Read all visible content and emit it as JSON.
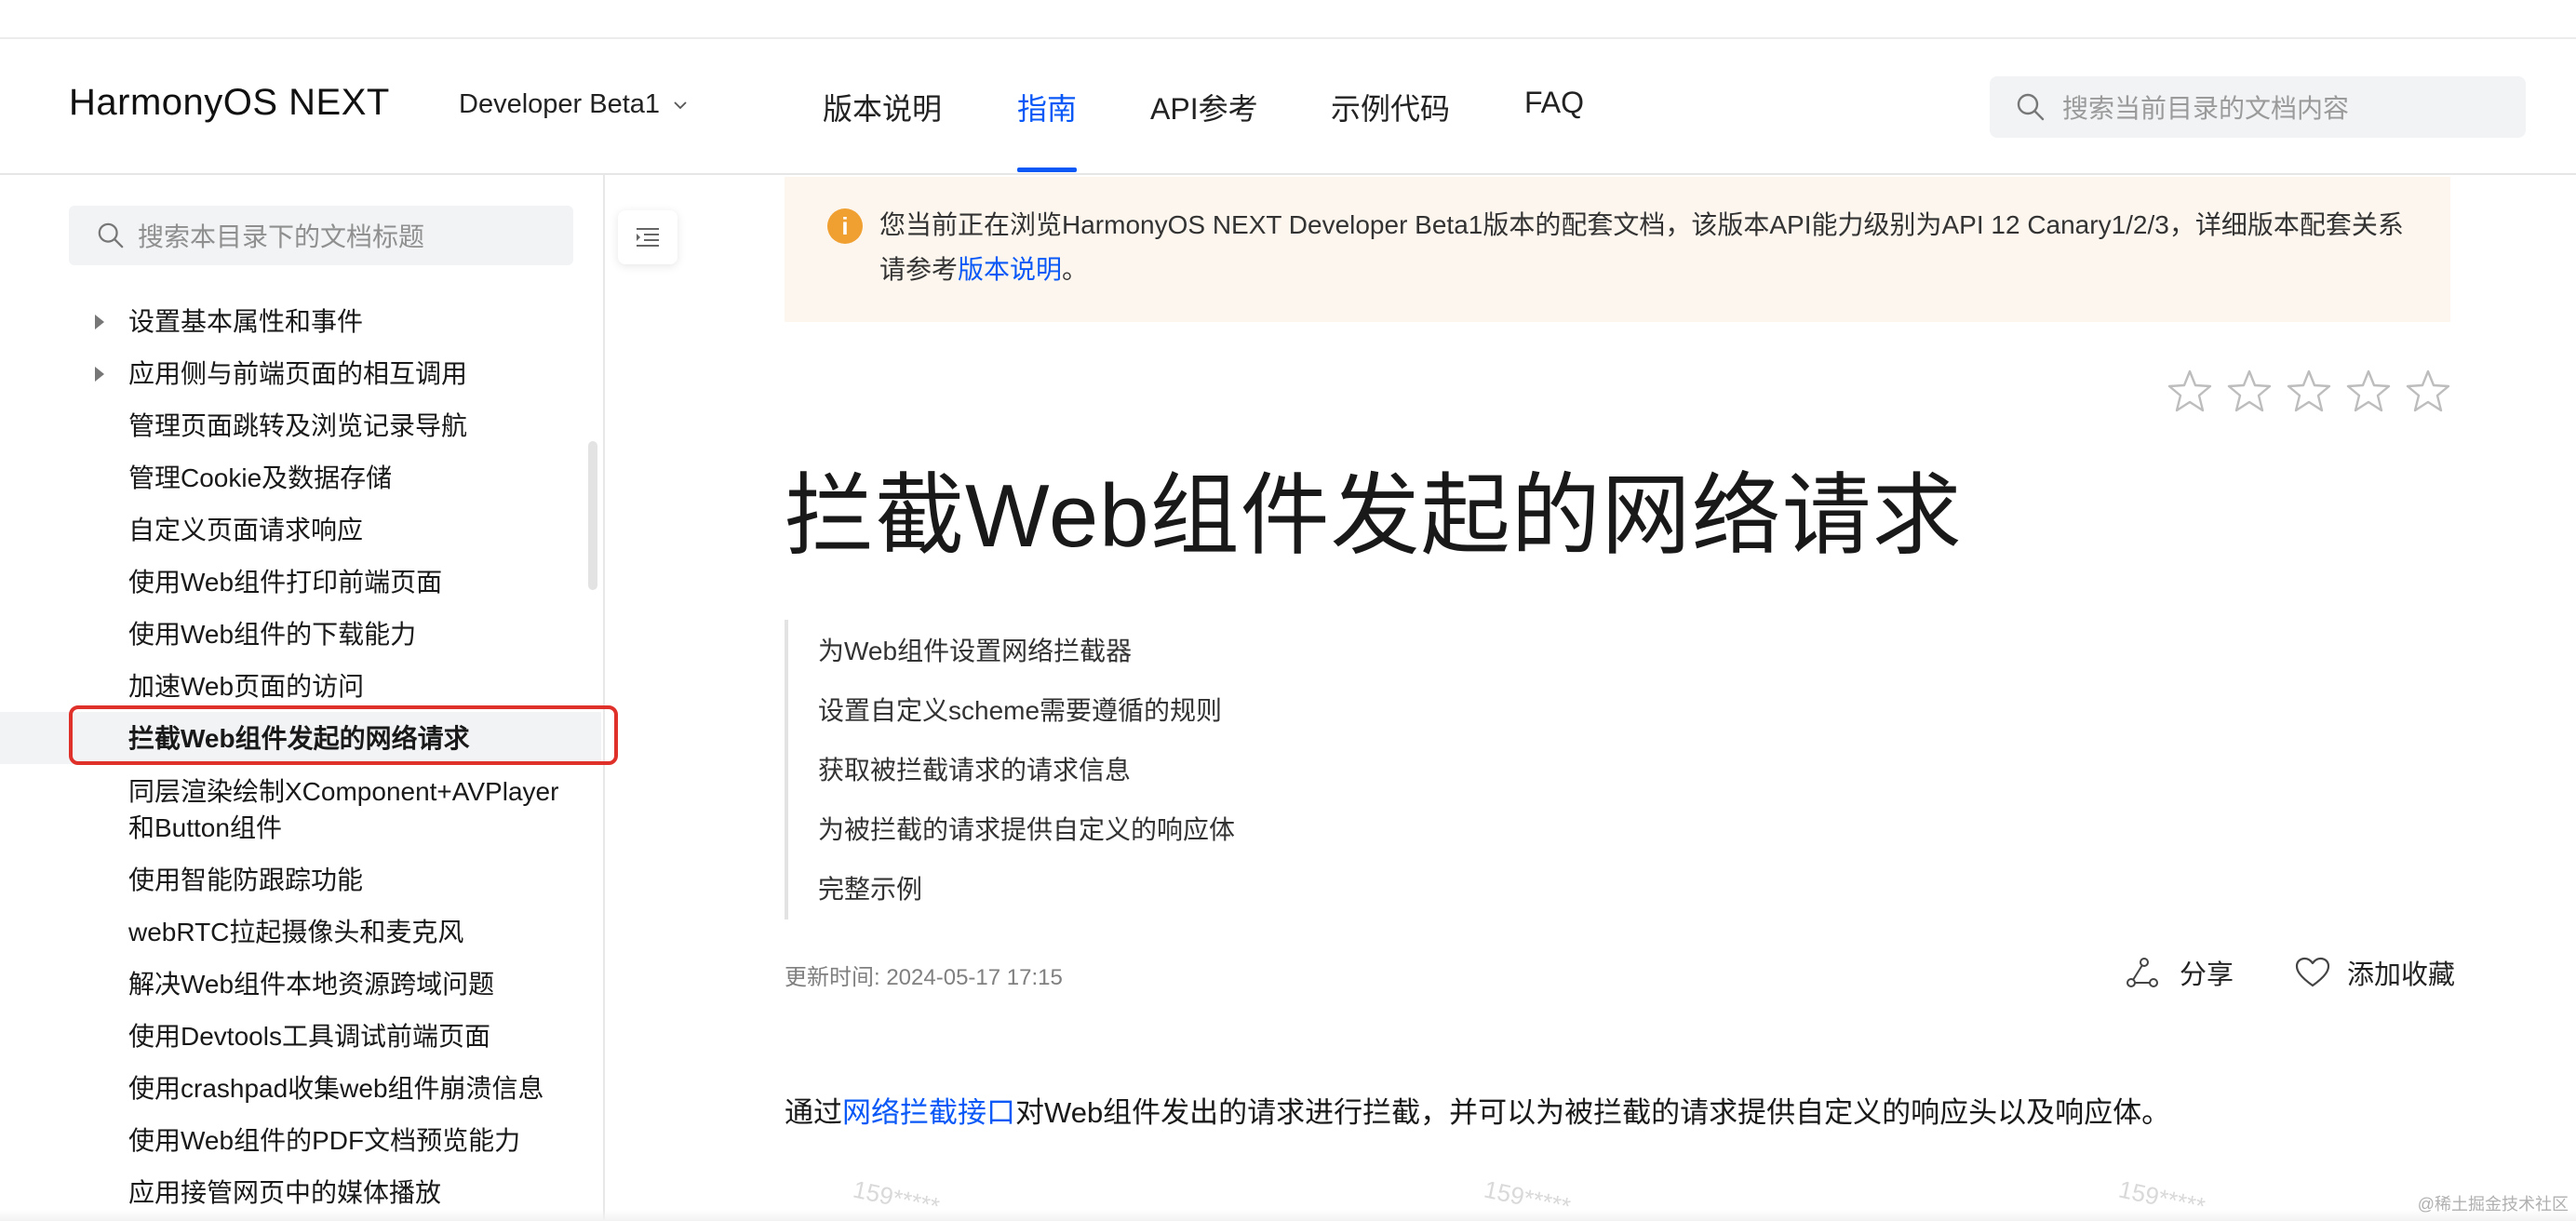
{
  "header": {
    "brand": "HarmonyOS NEXT",
    "version": "Developer Beta1",
    "nav": [
      {
        "label": "版本说明",
        "active": false
      },
      {
        "label": "指南",
        "active": true
      },
      {
        "label": "API参考",
        "active": false
      },
      {
        "label": "示例代码",
        "active": false
      },
      {
        "label": "FAQ",
        "active": false
      }
    ],
    "search_placeholder": "搜索当前目录的文档内容"
  },
  "sidebar": {
    "search_placeholder": "搜索本目录下的文档标题",
    "items": [
      {
        "label": "设置基本属性和事件",
        "expandable": true
      },
      {
        "label": "应用侧与前端页面的相互调用",
        "expandable": true
      },
      {
        "label": "管理页面跳转及浏览记录导航"
      },
      {
        "label": "管理Cookie及数据存储"
      },
      {
        "label": "自定义页面请求响应"
      },
      {
        "label": "使用Web组件打印前端页面"
      },
      {
        "label": "使用Web组件的下载能力"
      },
      {
        "label": "加速Web页面的访问"
      },
      {
        "label": "拦截Web组件发起的网络请求",
        "active": true
      },
      {
        "label": "同层渲染绘制XComponent+AVPlayer"
      },
      {
        "label": "和Button组件"
      },
      {
        "label": "使用智能防跟踪功能"
      },
      {
        "label": "webRTC拉起摄像头和麦克风"
      },
      {
        "label": "解决Web组件本地资源跨域问题"
      },
      {
        "label": "使用Devtools工具调试前端页面"
      },
      {
        "label": "使用crashpad收集web组件崩溃信息"
      },
      {
        "label": "使用Web组件的PDF文档预览能力"
      },
      {
        "label": "应用接管网页中的媒体播放"
      }
    ]
  },
  "notice": {
    "text_before": "您当前正在浏览HarmonyOS NEXT Developer Beta1版本的配套文档，该版本API能力级别为API 12 Canary1/2/3，详细版本配套关系请参考",
    "link": "版本说明",
    "text_after": "。"
  },
  "article": {
    "rating": {
      "value": 0,
      "max": 5
    },
    "title": "拦截Web组件发起的网络请求",
    "toc": [
      "为Web组件设置网络拦截器",
      "设置自定义scheme需要遵循的规则",
      "获取被拦截请求的请求信息",
      "为被拦截的请求提供自定义的响应体",
      "完整示例"
    ],
    "updated": "更新时间: 2024-05-17 17:15",
    "share_label": "分享",
    "favorite_label": "添加收藏",
    "intro_before": "通过",
    "intro_link": "网络拦截接口",
    "intro_after": "对Web组件发出的请求进行拦截，并可以为被拦截的请求提供自定义的响应头以及响应体。"
  },
  "watermark": {
    "text": "159*****",
    "footer": "@稀土掘金技术社区"
  },
  "colors": {
    "accent": "#0a59f7",
    "highlight": "#e0302a",
    "notice_bg": "#fdf6ee",
    "notice_icon": "#f0a031"
  }
}
